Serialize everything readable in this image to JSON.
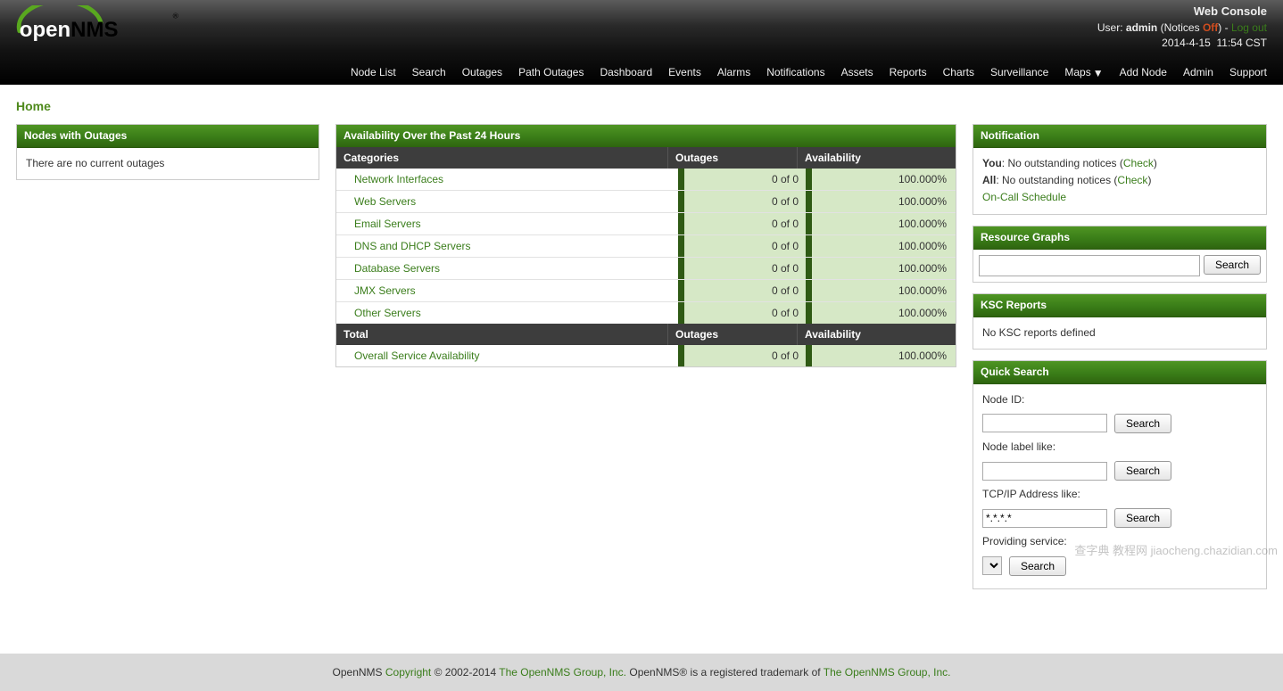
{
  "header": {
    "title": "Web Console",
    "user_label": "User:",
    "user": "admin",
    "notices_paren_open": "(Notices",
    "notices_status": "Off",
    "notices_paren_close": ")",
    "logout": "Log out",
    "datetime": "2014-4-15  11:54 CST",
    "nav": [
      "Node List",
      "Search",
      "Outages",
      "Path Outages",
      "Dashboard",
      "Events",
      "Alarms",
      "Notifications",
      "Assets",
      "Reports",
      "Charts",
      "Surveillance",
      "Maps",
      "Add Node",
      "Admin",
      "Support"
    ],
    "nav_maps_index": 12
  },
  "breadcrumb": "Home",
  "outages_panel": {
    "title": "Nodes with Outages",
    "body": "There are no current outages"
  },
  "avail": {
    "title": "Availability Over the Past 24 Hours",
    "head_cat": "Categories",
    "head_out": "Outages",
    "head_avail": "Availability",
    "rows": [
      {
        "name": "Network Interfaces",
        "out": "0 of 0",
        "avail": "100.000%"
      },
      {
        "name": "Web Servers",
        "out": "0 of 0",
        "avail": "100.000%"
      },
      {
        "name": "Email Servers",
        "out": "0 of 0",
        "avail": "100.000%"
      },
      {
        "name": "DNS and DHCP Servers",
        "out": "0 of 0",
        "avail": "100.000%"
      },
      {
        "name": "Database Servers",
        "out": "0 of 0",
        "avail": "100.000%"
      },
      {
        "name": "JMX Servers",
        "out": "0 of 0",
        "avail": "100.000%"
      },
      {
        "name": "Other Servers",
        "out": "0 of 0",
        "avail": "100.000%"
      }
    ],
    "foot_total": "Total",
    "foot_out": "Outages",
    "foot_avail": "Availability",
    "overall": {
      "name": "Overall Service Availability",
      "out": "0 of 0",
      "avail": "100.000%"
    }
  },
  "notif": {
    "title": "Notification",
    "you_label": "You",
    "you_text": ": No outstanding notices (",
    "check": "Check",
    "all_label": "All",
    "all_text": ": No outstanding notices (",
    "oncall": "On-Call Schedule"
  },
  "rg": {
    "title": "Resource Graphs",
    "search_btn": "Search"
  },
  "ksc": {
    "title": "KSC Reports",
    "body": "No KSC reports defined"
  },
  "qs": {
    "title": "Quick Search",
    "node_id": "Node ID:",
    "node_label": "Node label like:",
    "tcpip": "TCP/IP Address like:",
    "tcpip_default": "*.*.*.*",
    "service": "Providing service:",
    "search_btn": "Search"
  },
  "footer": {
    "product": "OpenNMS",
    "copyright_word": "Copyright",
    "years": "© 2002-2014",
    "group1": "The OpenNMS Group, Inc.",
    "trademark": "OpenNMS® is a registered trademark of",
    "group2": "The OpenNMS Group, Inc."
  },
  "watermark": "查字典  教程网\njiaocheng.chazidian.com"
}
